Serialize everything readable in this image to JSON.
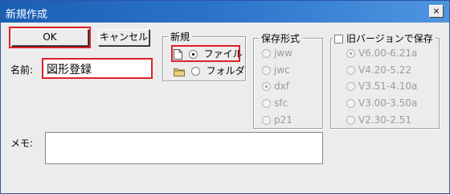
{
  "window": {
    "title": "新規作成",
    "close_label": "×"
  },
  "buttons": {
    "ok_label": "OK",
    "cancel_label": "キャンセル"
  },
  "name": {
    "label": "名前:",
    "value": "図形登録"
  },
  "memo": {
    "label": "メモ:",
    "value": ""
  },
  "new_group": {
    "title": "新規",
    "options": [
      {
        "label": "ファイル",
        "checked": true,
        "icon": "document-icon"
      },
      {
        "label": "フォルダ",
        "checked": false,
        "icon": "folder-icon"
      }
    ]
  },
  "save_format": {
    "title": "保存形式",
    "options": [
      {
        "label": "jww",
        "checked": false
      },
      {
        "label": "jwc",
        "checked": false
      },
      {
        "label": "dxf",
        "checked": true
      },
      {
        "label": "sfc",
        "checked": false
      },
      {
        "label": "p21",
        "checked": false
      }
    ]
  },
  "old_version": {
    "title": "旧バージョンで保存",
    "checked": false,
    "options": [
      {
        "label": "V6.00-6.21a",
        "checked": true
      },
      {
        "label": "V4.20-5.22",
        "checked": false
      },
      {
        "label": "V3.51-4.10a",
        "checked": false
      },
      {
        "label": "V3.00-3.50a",
        "checked": false
      },
      {
        "label": "V2.30-2.51",
        "checked": false
      }
    ]
  },
  "colors": {
    "titlebar": "#1b5fb3",
    "highlight": "#e0202a",
    "dialog_bg": "#ececec"
  }
}
